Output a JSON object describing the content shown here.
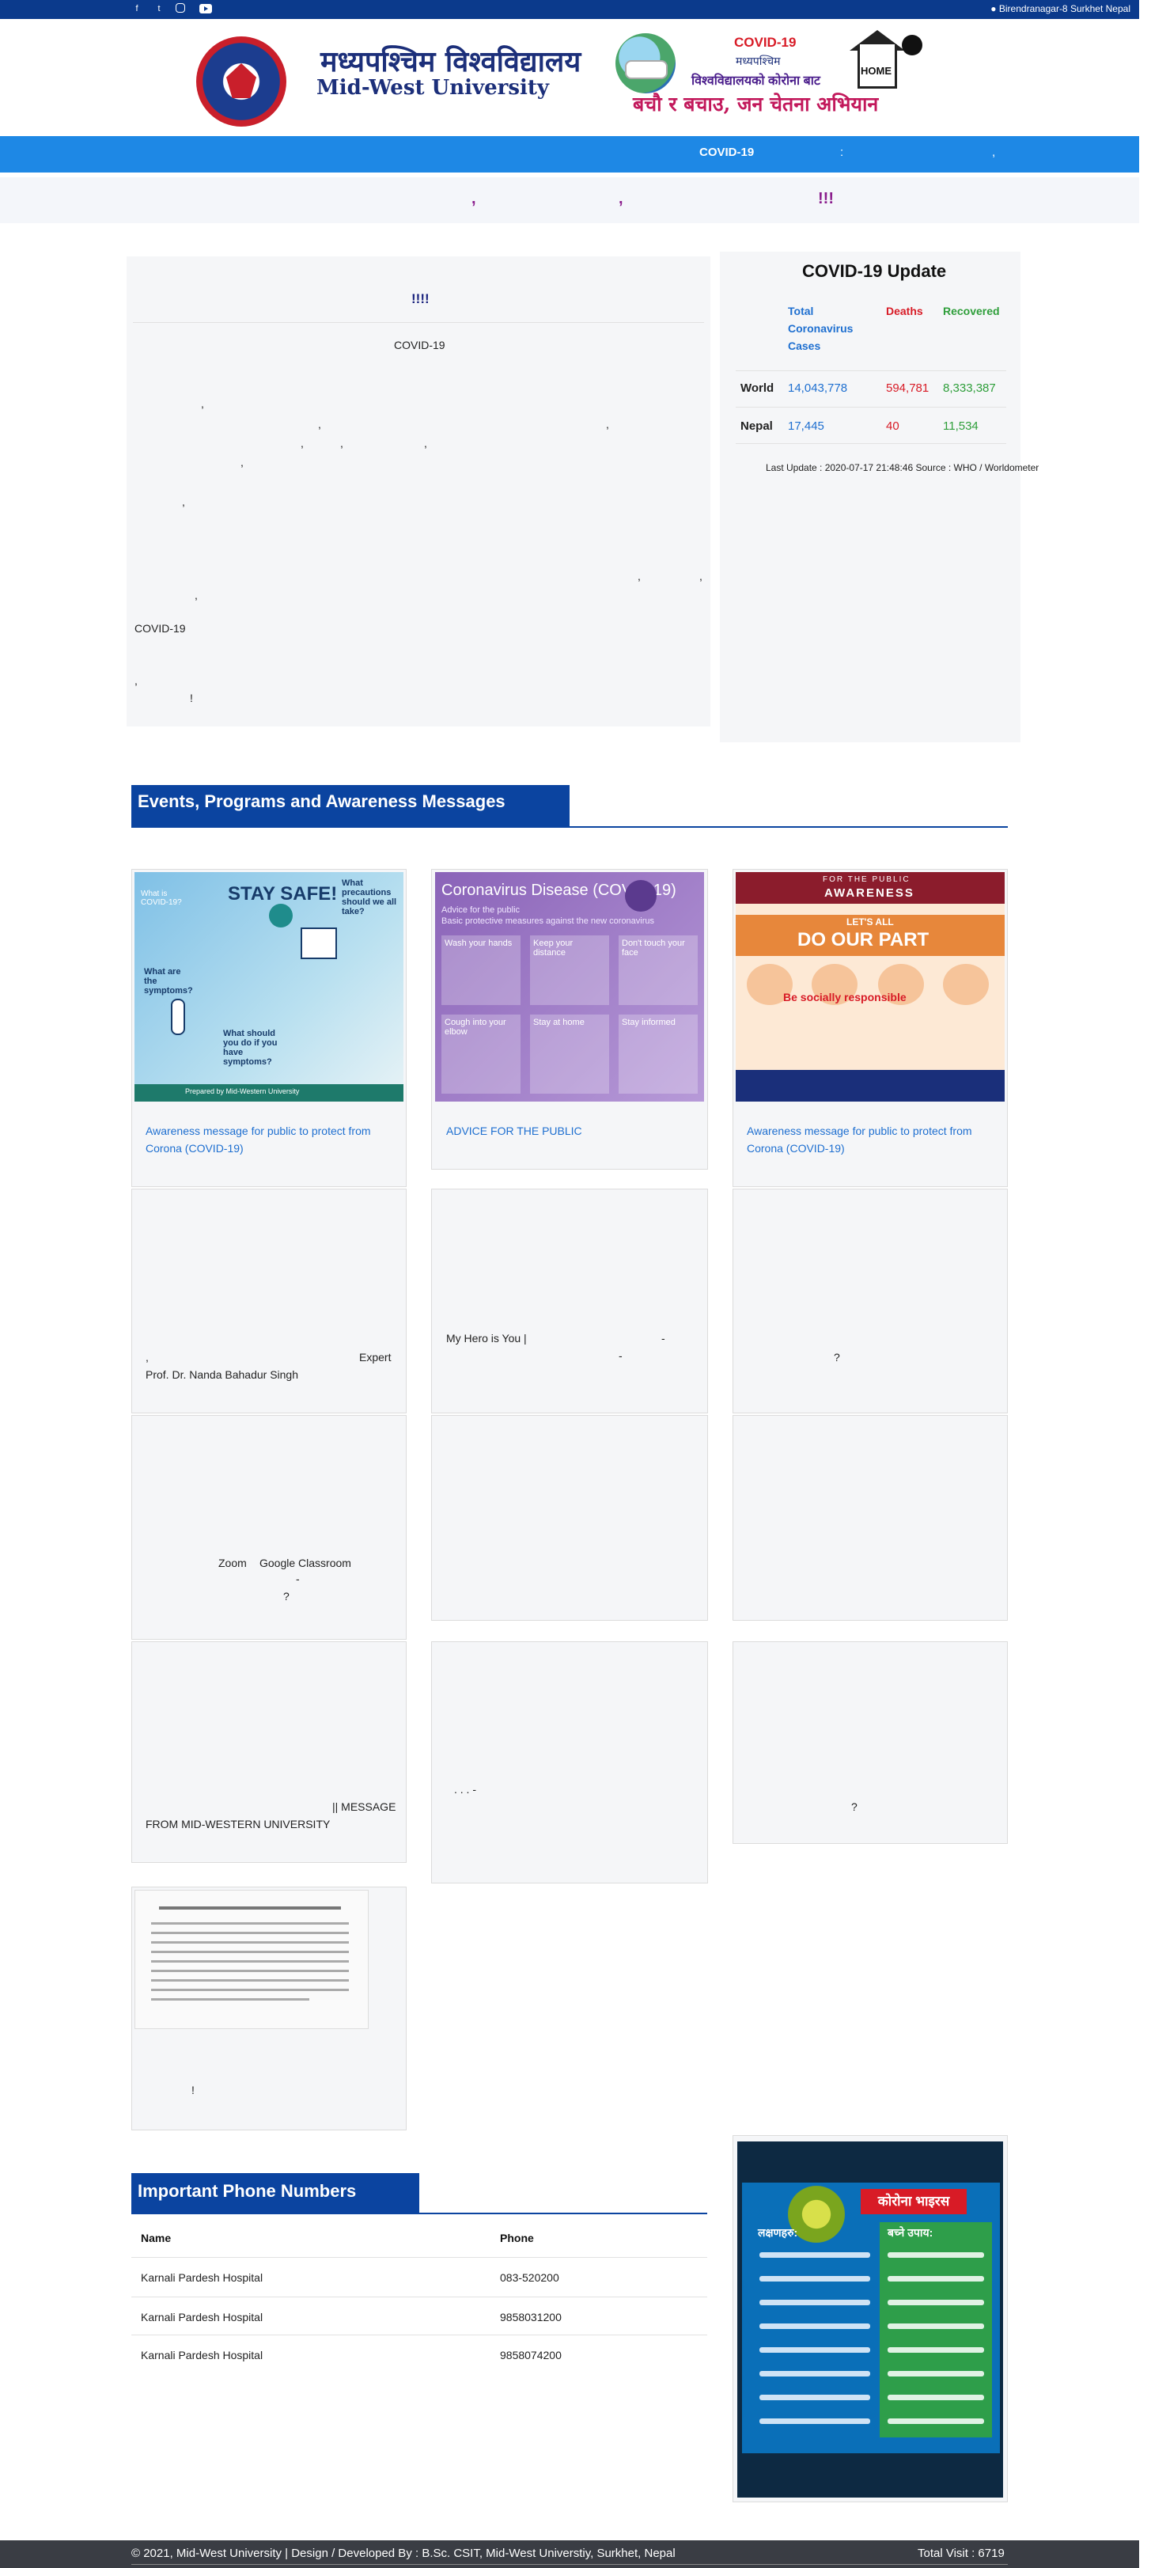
{
  "topbar": {
    "social": [
      "facebook-icon",
      "twitter-icon",
      "instagram-icon",
      "youtube-icon"
    ],
    "address": "Birendranagar-8 Surkhet Nepal"
  },
  "header": {
    "university_name_np": "मध्यपश्चिम विश्वविद्यालय",
    "university_name_en": "Mid-West University",
    "covid_banner": {
      "title": "COVID-19",
      "line1": "मध्यपश्चिम",
      "line2": "विश्वविद्यालयको कोरोना बाट",
      "home_label": "HOME",
      "slogan": "बचौ र बचाउ, जन चेतना अभियान"
    }
  },
  "banner": {
    "text": "COVID-19",
    "colon": ":",
    "comma": ","
  },
  "marquee": {
    "parts": [
      ",",
      ",",
      "!!!"
    ]
  },
  "notice": {
    "title": "!!!!",
    "subtitle": "COVID-19",
    "frag1": ",",
    "frag2": ",",
    "frag3": ",",
    "frag4": ",",
    "frag5": ",",
    "frag6": ",",
    "frag7": ",",
    "frag8": ",",
    "frag9": ",",
    "frag10": ",",
    "frag11": ",",
    "frag12": ",",
    "covid_word": "COVID-19",
    "frag13": ",",
    "frag14": "!"
  },
  "covid_update": {
    "title": "COVID-19 Update",
    "headers": {
      "total": "Total Coronavirus Cases",
      "deaths": "Deaths",
      "recovered": "Recovered"
    },
    "rows": [
      {
        "region": "World",
        "total": "14,043,778",
        "deaths": "594,781",
        "recovered": "8,333,387"
      },
      {
        "region": "Nepal",
        "total": "17,445",
        "deaths": "40",
        "recovered": "11,534"
      }
    ],
    "last_update": "Last Update : 2020-07-17 21:48:46 Source : WHO / Worldometer",
    "colors": {
      "total": "#1e6fd0",
      "deaths": "#d81b26",
      "recovered": "#2e9e3a"
    }
  },
  "events": {
    "heading": "Events, Programs and Awareness Messages",
    "cards": [
      {
        "title": "Awareness message for public to protect from Corona (COVID-19)",
        "thumb": "stay-safe-poster"
      },
      {
        "title": "ADVICE FOR THE PUBLIC",
        "thumb": "coronavirus-advice-poster"
      },
      {
        "title": "Awareness message for public to protect from Corona (COVID-19)",
        "thumb": "do-our-part-poster"
      }
    ],
    "text_cards": {
      "c4_comma": ",",
      "c4_expert": "Expert",
      "c4_name": "Prof. Dr. Nanda Bahadur Singh",
      "c5_text": "My Hero is You |",
      "c5_dash1": "-",
      "c5_dash2": "-",
      "c6_q": "?",
      "c7_zoom": "Zoom",
      "c7_gc": "Google Classroom",
      "c7_dash": "-",
      "c7_q": "?",
      "c10_msg": "|| MESSAGE",
      "c10_from": "FROM MID-WESTERN UNIVERSITY",
      "c11_dots": ".  .  .  -",
      "c12_q": "?",
      "c13_excl": "!"
    },
    "poster_texts": {
      "stay_safe": "STAY SAFE!",
      "what_is": "What is COVID-19?",
      "precautions": "What precautions should we all take?",
      "symptoms": "What are the symptoms?",
      "should_do": "What should you do if you have symptoms?",
      "prepared_by": "Prepared by Mid-Western University",
      "advice_title": "Coronavirus Disease (COVID-19)",
      "advice_sub1": "Advice for the public",
      "advice_sub2": "Basic protective measures against the new coronavirus",
      "advice_cells": [
        "Wash your hands",
        "Keep your distance",
        "Don't touch your face",
        "Cough into your elbow",
        "Stay at home",
        "Stay informed"
      ],
      "public_label": "FOR THE PUBLIC",
      "awareness": "AWARENESS",
      "lets_all": "LET'S ALL",
      "do_our_part": "DO OUR PART",
      "responsible": "Be socially responsible"
    }
  },
  "phones": {
    "heading": "Important Phone Numbers",
    "columns": [
      "Name",
      "Phone"
    ],
    "rows": [
      {
        "name": "Karnali Pardesh Hospital",
        "phone": "083-520200"
      },
      {
        "name": "Karnali Pardesh Hospital",
        "phone": "9858031200"
      },
      {
        "name": "Karnali Pardesh Hospital",
        "phone": "9858074200"
      }
    ]
  },
  "poster": {
    "tag": "कोरोना भाइरस",
    "left_title": "लक्षणहरु:",
    "right_title": "बच्ने उपाय:"
  },
  "footer": {
    "copyright": "© 2021, Mid-West University | Design / Developed By : B.Sc. CSIT, Mid-West Universtiy, Surkhet, Nepal",
    "visits": "Total Visit : 6719"
  }
}
